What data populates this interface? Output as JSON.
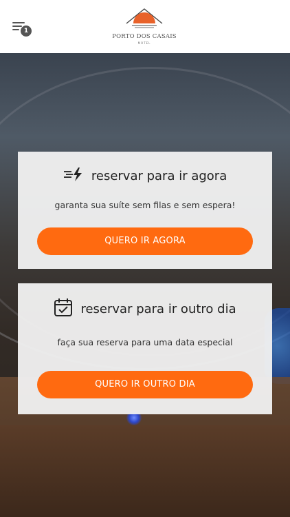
{
  "header": {
    "menu_badge": "1",
    "logo_name": "PORTO DOS CASAIS",
    "logo_sub": "MOTEL"
  },
  "colors": {
    "accent": "#ff6a10",
    "logo_sun": "#e8622a",
    "card_bg": "#f0f0f0"
  },
  "now_card": {
    "icon": "fast-lightning-icon",
    "title": "reservar para ir agora",
    "subtitle": "garanta sua suíte sem filas e sem espera!",
    "button_label": "QUERO IR AGORA"
  },
  "later_card": {
    "icon": "calendar-check-icon",
    "title": "reservar para ir outro dia",
    "subtitle": "faça sua reserva para uma data especial",
    "button_label": "QUERO IR OUTRO DIA"
  }
}
